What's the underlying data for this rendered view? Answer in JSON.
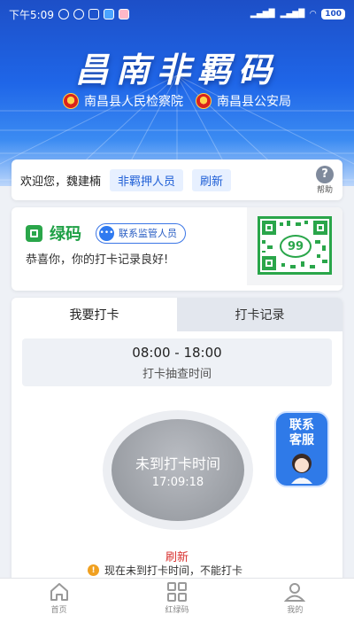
{
  "status_bar": {
    "time": "下午5:09",
    "battery": "100"
  },
  "header": {
    "title": "昌南非羁码",
    "agencies": [
      "南昌县人民检察院",
      "南昌县公安局"
    ]
  },
  "welcome": {
    "greeting": "欢迎您，魏建楠",
    "role_chip": "非羁押人员",
    "refresh_chip": "刷新",
    "help_label": "帮助"
  },
  "code_card": {
    "status": "绿码",
    "contact_label": "联系监管人员",
    "message": "恭喜你，你的打卡记录良好!",
    "qr_number": "99"
  },
  "tabs": [
    {
      "label": "我要打卡"
    },
    {
      "label": "打卡记录"
    }
  ],
  "checkin": {
    "time_range": "08:00 - 18:00",
    "time_label": "打卡抽查时间",
    "button_text": "未到打卡时间",
    "current_time": "17:09:18",
    "refresh": "刷新",
    "notice": "现在未到打卡时间，不能打卡"
  },
  "service": {
    "label_line1": "联系",
    "label_line2": "客服"
  },
  "bottom_nav": [
    {
      "label": "首页"
    },
    {
      "label": "红绿码"
    },
    {
      "label": "我的"
    }
  ],
  "colors": {
    "primary": "#1f66e8",
    "green": "#2aa64a",
    "red": "#d8302e",
    "warning": "#f0a020"
  }
}
